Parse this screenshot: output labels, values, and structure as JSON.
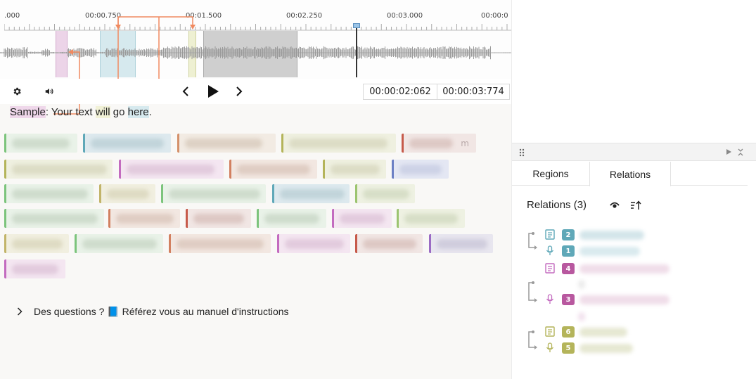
{
  "timeline": {
    "tick_labels": [
      ".000",
      "00:00.750",
      "00:01.500",
      "00:02.250",
      "00:03.000",
      "00:00:0"
    ]
  },
  "controls": {
    "current_time": "00:00:02:062",
    "duration": "00:00:03:774"
  },
  "text_line": {
    "w1": "Sample",
    "s1": ": Your text ",
    "w2": "will",
    "s2": " go ",
    "w3": "here",
    "s3": "."
  },
  "chip_tail_letter": "m",
  "footer": {
    "text": "Des questions ? 📘 Référez vous au manuel d'instructions"
  },
  "panel": {
    "tabs": [
      "Regions",
      "Relations"
    ],
    "relations_title": "Relations (3)",
    "badges": [
      "2",
      "1",
      "4",
      "3",
      "6",
      "5"
    ]
  },
  "colors": {
    "pink": "#c36bbf",
    "blue": "#5fa8b8",
    "olive": "#b4b45a",
    "orange_arrow": "#f08a60",
    "green": "#7cc47c",
    "navy": "#6b7fc4"
  }
}
